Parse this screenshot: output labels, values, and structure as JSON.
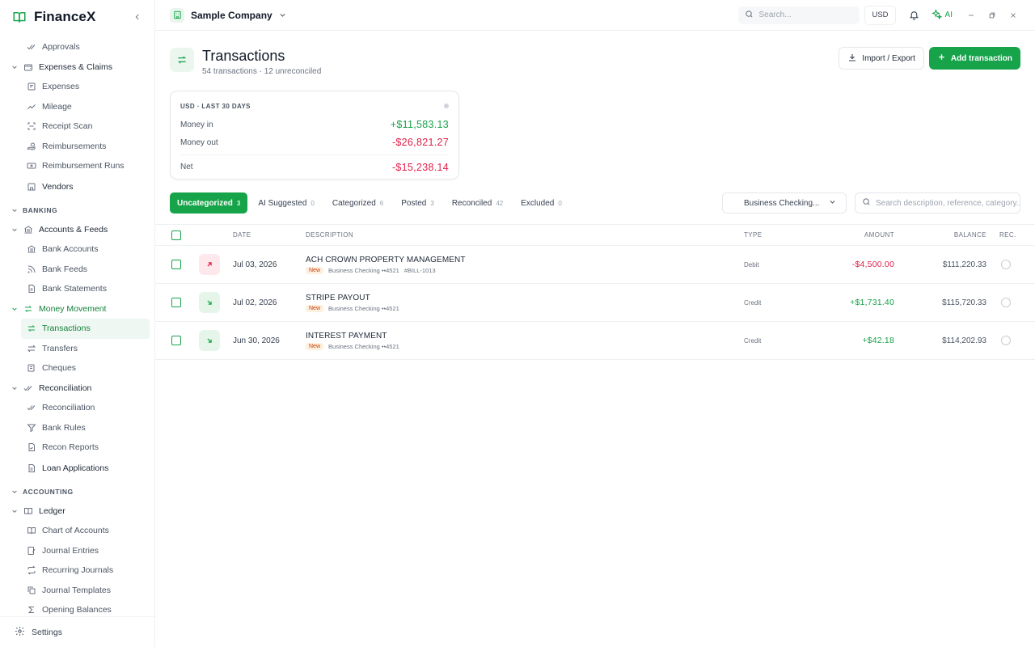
{
  "brand": {
    "name": "FinanceX"
  },
  "nav": {
    "approvals": "Approvals",
    "expenses_claims": "Expenses & Claims",
    "expenses": "Expenses",
    "mileage": "Mileage",
    "receipt_scan": "Receipt Scan",
    "reimbursements": "Reimbursements",
    "reimbursement_runs": "Reimbursement Runs",
    "vendors": "Vendors",
    "banking_section": "BANKING",
    "accounts_feeds": "Accounts & Feeds",
    "bank_accounts": "Bank Accounts",
    "bank_feeds": "Bank Feeds",
    "bank_statements": "Bank Statements",
    "money_movement": "Money Movement",
    "transactions": "Transactions",
    "transfers": "Transfers",
    "cheques": "Cheques",
    "reconciliation_group": "Reconciliation",
    "reconciliation": "Reconciliation",
    "bank_rules": "Bank Rules",
    "recon_reports": "Recon Reports",
    "loan_applications": "Loan Applications",
    "accounting_section": "ACCOUNTING",
    "ledger": "Ledger",
    "chart_of_accounts": "Chart of Accounts",
    "journal_entries": "Journal Entries",
    "recurring_journals": "Recurring Journals",
    "journal_templates": "Journal Templates",
    "opening_balances": "Opening Balances",
    "settings": "Settings"
  },
  "topbar": {
    "company": "Sample Company",
    "search_placeholder": "Search...",
    "currency": "USD",
    "ai_label": "AI"
  },
  "page": {
    "title": "Transactions",
    "subtitle": "54 transactions · 12 unreconciled",
    "import_export": "Import / Export",
    "add_transaction": "Add transaction"
  },
  "summary": {
    "header": "USD · LAST 30 DAYS",
    "money_in_label": "Money in",
    "money_in_value": "+$11,583.13",
    "money_out_label": "Money out",
    "money_out_value": "-$26,821.27",
    "net_label": "Net",
    "net_value": "-$15,238.14"
  },
  "tabs": [
    {
      "label": "Uncategorized",
      "count": "3"
    },
    {
      "label": "AI Suggested",
      "count": "0"
    },
    {
      "label": "Categorized",
      "count": "6"
    },
    {
      "label": "Posted",
      "count": "3"
    },
    {
      "label": "Reconciled",
      "count": "42"
    },
    {
      "label": "Excluded",
      "count": "0"
    }
  ],
  "filters": {
    "account": "Business Checking...",
    "search_placeholder": "Search description, reference, category..."
  },
  "table": {
    "headers": {
      "date": "DATE",
      "description": "DESCRIPTION",
      "type": "TYPE",
      "amount": "AMOUNT",
      "balance": "BALANCE",
      "rec": "REC."
    },
    "rows": [
      {
        "date": "Jul 03, 2026",
        "description": "ACH CROWN PROPERTY MANAGEMENT",
        "status": "New",
        "account": "Business Checking ••4521",
        "reference": "#BILL-1013",
        "type": "Debit",
        "amount": "-$4,500.00",
        "balance": "$111,220.33"
      },
      {
        "date": "Jul 02, 2026",
        "description": "STRIPE PAYOUT",
        "status": "New",
        "account": "Business Checking ••4521",
        "reference": "",
        "type": "Credit",
        "amount": "+$1,731.40",
        "balance": "$115,720.33"
      },
      {
        "date": "Jun 30, 2026",
        "description": "INTEREST PAYMENT",
        "status": "New",
        "account": "Business Checking ••4521",
        "reference": "",
        "type": "Credit",
        "amount": "+$42.18",
        "balance": "$114,202.93"
      }
    ]
  },
  "colors": {
    "accent": "#16a34a",
    "negative": "#e11d48",
    "status_new_bg": "#fdf0df"
  }
}
